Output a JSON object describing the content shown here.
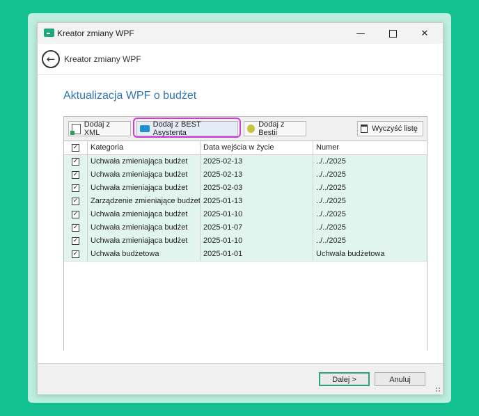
{
  "window": {
    "title": "Kreator zmiany WPF",
    "controls": {
      "minimize": "—",
      "close": "✕"
    }
  },
  "nav": {
    "back_icon": "←",
    "title": "Kreator zmiany WPF"
  },
  "page": {
    "heading": "Aktualizacja WPF o budżet"
  },
  "toolbar": {
    "add_xml": "Dodaj z XML",
    "add_best": "Dodaj z BEST Asystenta",
    "add_bestii": "Dodaj z Bestii",
    "clear": "Wyczyść listę"
  },
  "table": {
    "header_check": "✓",
    "columns": [
      "Kategoria",
      "Data wejścia w życie",
      "Numer"
    ],
    "rows": [
      {
        "checked": "✓",
        "kategoria": "Uchwała zmieniająca budżet",
        "data": "2025-02-13",
        "numer": "../../2025"
      },
      {
        "checked": "✓",
        "kategoria": "Uchwała zmieniająca budżet",
        "data": "2025-02-13",
        "numer": "../../2025"
      },
      {
        "checked": "✓",
        "kategoria": "Uchwała zmieniająca budżet",
        "data": "2025-02-03",
        "numer": "../../2025"
      },
      {
        "checked": "✓",
        "kategoria": "Zarządzenie zmieniające budżet",
        "data": "2025-01-13",
        "numer": "../../2025"
      },
      {
        "checked": "✓",
        "kategoria": "Uchwała zmieniająca budżet",
        "data": "2025-01-10",
        "numer": "../../2025"
      },
      {
        "checked": "✓",
        "kategoria": "Uchwała zmieniająca budżet",
        "data": "2025-01-07",
        "numer": "../../2025"
      },
      {
        "checked": "✓",
        "kategoria": "Uchwała zmieniająca budżet",
        "data": "2025-01-10",
        "numer": "../../2025"
      },
      {
        "checked": "✓",
        "kategoria": "Uchwała budżetowa",
        "data": "2025-01-01",
        "numer": "Uchwała budżetowa"
      }
    ]
  },
  "footer": {
    "next": "Dalej >",
    "cancel": "Anuluj"
  },
  "colors": {
    "background": "#13c08f",
    "accent_title": "#2e74b5",
    "highlight": "#d23ad6",
    "row_fill": "#e1f4ee"
  }
}
